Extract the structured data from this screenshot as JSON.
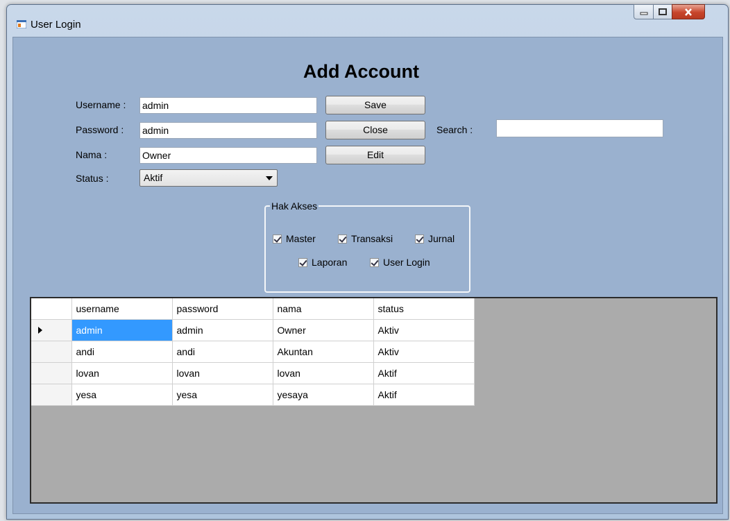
{
  "window": {
    "title": "User Login"
  },
  "form": {
    "heading": "Add Account",
    "username": {
      "label": "Username :",
      "value": "admin"
    },
    "password": {
      "label": "Password :",
      "value": "admin"
    },
    "nama": {
      "label": "Nama :",
      "value": "Owner"
    },
    "status": {
      "label": "Status :",
      "value": "Aktif"
    },
    "search": {
      "label": "Search :",
      "value": ""
    }
  },
  "buttons": {
    "save": "Save",
    "close": "Close",
    "edit": "Edit"
  },
  "hak_akses": {
    "title": "Hak Akses",
    "items": [
      {
        "label": "Master",
        "checked": true
      },
      {
        "label": "Transaksi",
        "checked": true
      },
      {
        "label": "Jurnal",
        "checked": true
      },
      {
        "label": "Laporan",
        "checked": true
      },
      {
        "label": "User Login",
        "checked": true
      }
    ]
  },
  "table": {
    "columns": [
      "username",
      "password",
      "nama",
      "status"
    ],
    "rows": [
      [
        "admin",
        "admin",
        "Owner",
        "Aktiv"
      ],
      [
        "andi",
        "andi",
        "Akuntan",
        "Aktiv"
      ],
      [
        "lovan",
        "lovan",
        "lovan",
        "Aktif"
      ],
      [
        "yesa",
        "yesa",
        "yesaya",
        "Aktif"
      ]
    ]
  },
  "colors": {
    "client_bg": "#9ab1cf",
    "selection": "#3399ff",
    "grid_bg": "#ababab"
  }
}
